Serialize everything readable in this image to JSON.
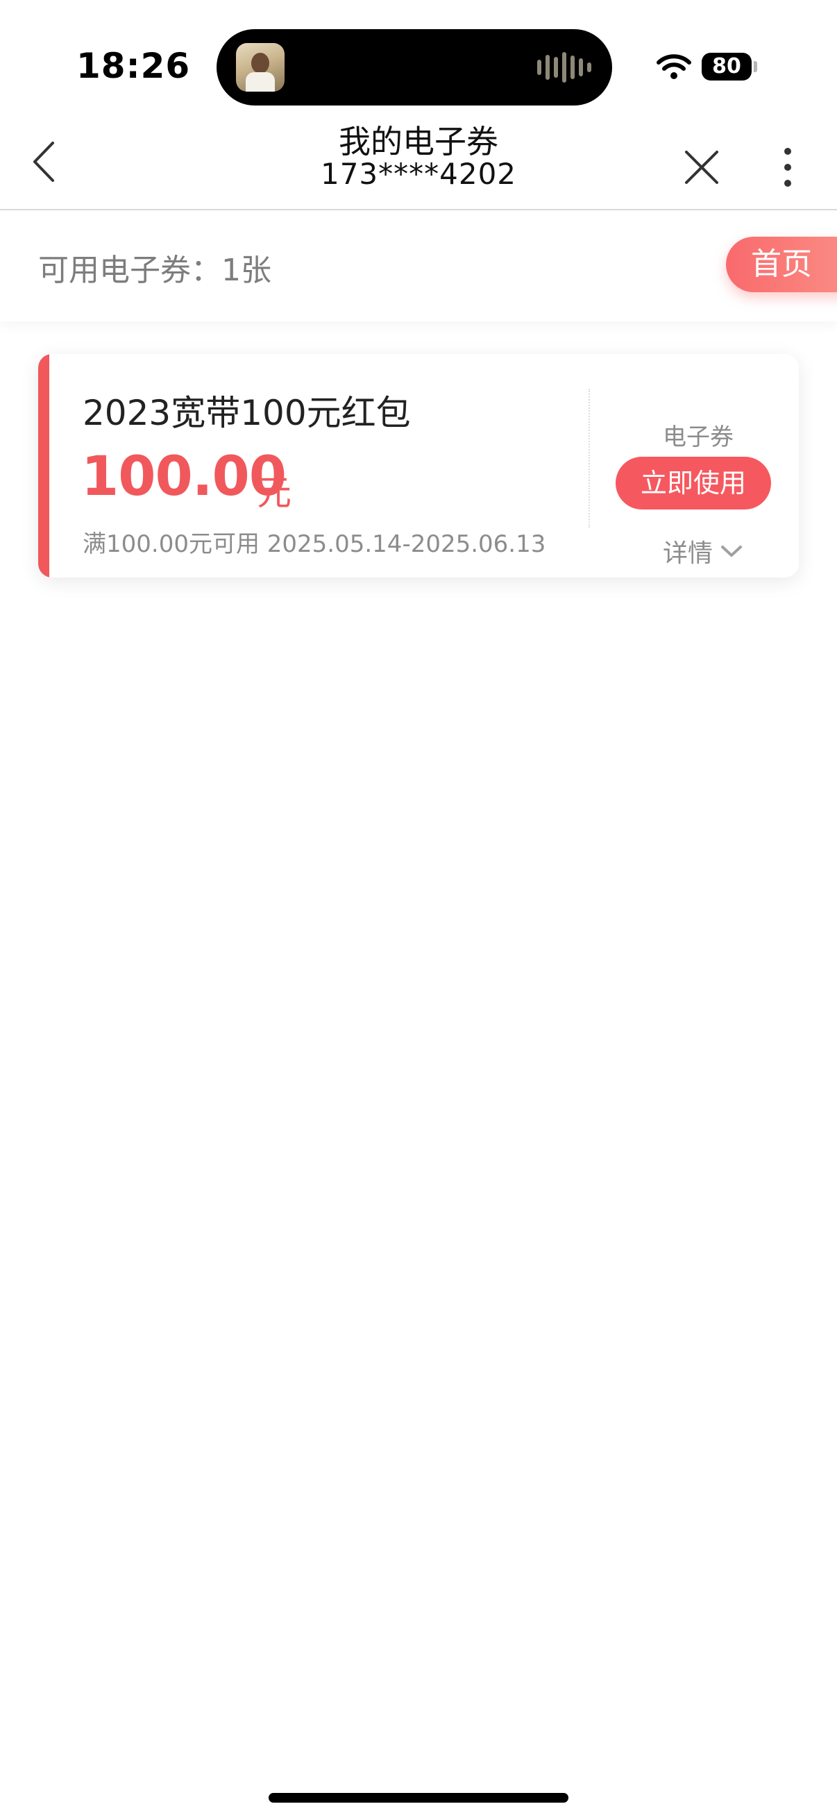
{
  "status_bar": {
    "time": "18:26",
    "battery": "80",
    "icons": [
      "wifi-icon",
      "battery-icon"
    ]
  },
  "nav": {
    "title": "我的电子券",
    "subtitle": "173****4202",
    "icons": [
      "back-arrow-icon",
      "close-icon",
      "more-vertical-icon"
    ]
  },
  "summary": {
    "available_text": "可用电子券：1张",
    "home_button": "首页"
  },
  "coupons": [
    {
      "title": "2023宽带100元红包",
      "amount": "100.00",
      "unit": "元",
      "condition": "满100.00元可用 2025.05.14-2025.06.13",
      "type": "电子券",
      "use_button": "立即使用",
      "detail": "详情"
    }
  ],
  "colors": {
    "accent": "#f1585c",
    "button": "#f6585f",
    "muted_text": "#8c8c8c"
  }
}
